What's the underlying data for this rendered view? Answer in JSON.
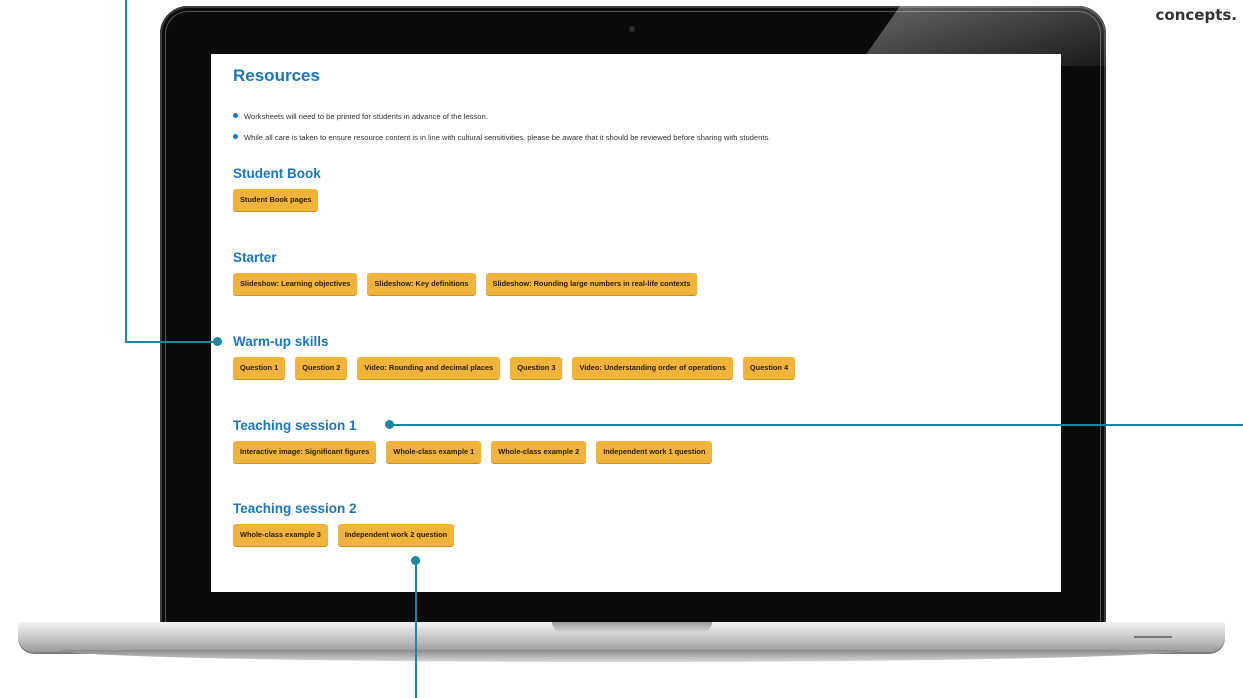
{
  "corner_text": "concepts.",
  "screen": {
    "resources_title": "Resources",
    "bullets": [
      "Worksheets will need to be printed for students in advance of the lesson.",
      "While all care is taken to ensure resource content is in line with cultural sensitivities, please be aware that it should be reviewed before sharing with students."
    ],
    "sections": [
      {
        "heading": "Student Book",
        "buttons": [
          "Student Book pages"
        ]
      },
      {
        "heading": "Starter",
        "buttons": [
          "Slideshow: Learning objectives",
          "Slideshow: Key definitions",
          "Slideshow: Rounding large numbers in real-life contexts"
        ]
      },
      {
        "heading": "Warm-up skills",
        "buttons": [
          "Question 1",
          "Question 2",
          "Video: Rounding and decimal places",
          "Question 3",
          "Video: Understanding order of operations",
          "Question 4"
        ]
      },
      {
        "heading": "Teaching session 1",
        "buttons": [
          "Interactive image: Significant figures",
          "Whole-class example 1",
          "Whole-class example 2",
          "Independent work 1 question"
        ]
      },
      {
        "heading": "Teaching session 2",
        "buttons": [
          "Whole-class example 3",
          "Independent work 2 question"
        ]
      }
    ]
  },
  "colors": {
    "heading_blue": "#1d76c4",
    "button_yellow": "#f2b33a",
    "callout_teal": "#1a87a3"
  }
}
